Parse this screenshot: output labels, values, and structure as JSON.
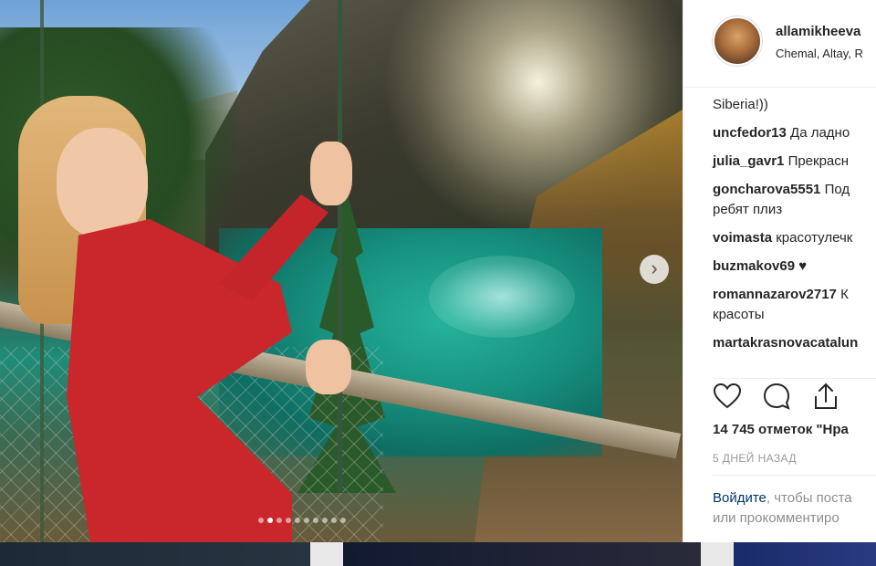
{
  "post": {
    "username": "allamikheeva",
    "location": "Chemal, Altay, R",
    "caption_fragment": "Siberia!))",
    "comments": [
      {
        "user": "uncfedor13",
        "text": "Да ладно"
      },
      {
        "user": "julia_gavr1",
        "text": "Прекрасн"
      },
      {
        "user": "goncharova5551",
        "text": "Под",
        "text2": "ребят плиз"
      },
      {
        "user": "voimasta",
        "text": "красотулечк"
      },
      {
        "user": "buzmakov69",
        "text": "♥"
      },
      {
        "user": "romannazarov2717",
        "text": "К",
        "text2": "красоты"
      },
      {
        "user": "martakrasnovacatalun",
        "text": ""
      }
    ],
    "likes": "14 745 отметок \"Нра",
    "date": "5 ДНЕЙ НАЗАД",
    "login_link": "Войдите",
    "login_text": ", чтобы поста",
    "login_text2": "или прокомментиро"
  },
  "carousel": {
    "dot_count": 10,
    "active_index": 1,
    "next_icon": "chevron-right-icon"
  },
  "icons": {
    "like": "heart-icon",
    "comment": "comment-bubble-icon",
    "share": "share-upload-icon"
  },
  "colors": {
    "link": "#003569",
    "muted": "#999999",
    "text": "#262626"
  }
}
